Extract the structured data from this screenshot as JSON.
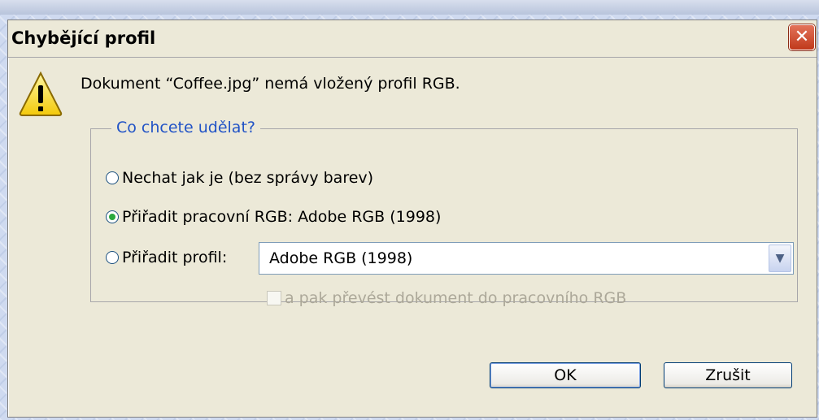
{
  "dialog": {
    "title": "Chybějící profil",
    "close_label": "✕",
    "message": "Dokument “Coffee.jpg” nemá vložený profil RGB.",
    "group_legend": "Co chcete udělat?",
    "options": [
      {
        "label": "Nechat jak je (bez správy barev)",
        "selected": false
      },
      {
        "label": "Přiřadit pracovní RGB:  Adobe RGB (1998)",
        "selected": true
      },
      {
        "label": "Přiřadit profil:",
        "selected": false
      }
    ],
    "profile_select_value": "Adobe RGB (1998)",
    "convert_checkbox_label": "a pak převést dokument do pracovního RGB",
    "convert_checkbox_checked": false,
    "ok_label": "OK",
    "cancel_label": "Zrušit"
  },
  "icons": {
    "warning": "warning-icon",
    "close": "close-icon",
    "dropdown": "chevron-down-icon"
  },
  "colors": {
    "dialog_bg": "#ece9d8",
    "legend_text": "#2153c6",
    "close_button": "#c0391b"
  }
}
